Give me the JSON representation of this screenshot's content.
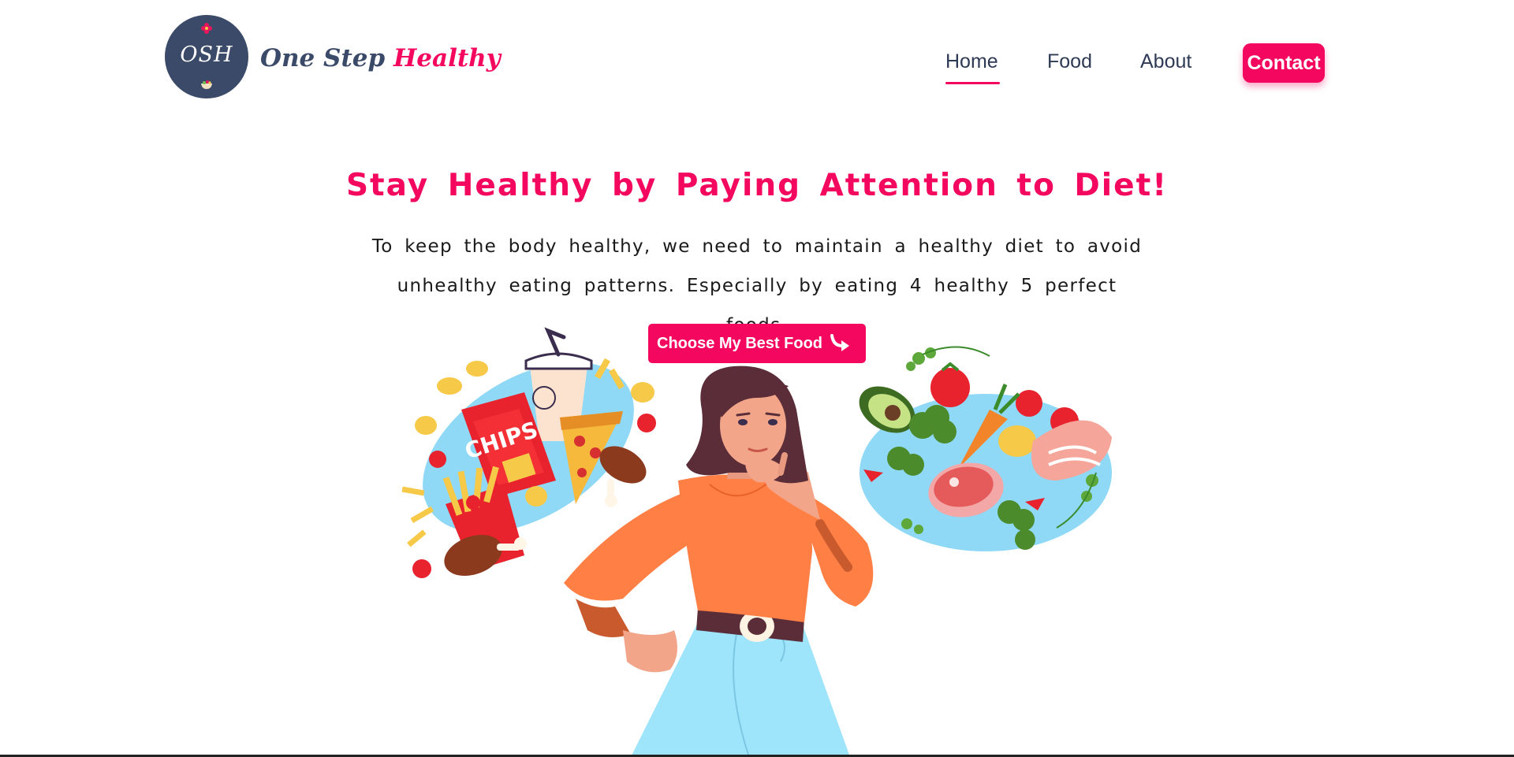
{
  "brand": {
    "logo_text": "OSH",
    "name_part1": "One Step",
    "name_part2": "Healthy"
  },
  "nav": {
    "items": [
      "Home",
      "Food",
      "About"
    ],
    "active": "Home",
    "contact_label": "Contact"
  },
  "hero": {
    "title": "Stay Healthy by Paying Attention to Diet!",
    "description": "To keep the body healthy, we need to maintain a healthy diet to avoid unhealthy eating patterns. Especially by eating 4 healthy 5 perfect foods.",
    "cta_label": "Choose My Best Food",
    "illustration": {
      "left_plate": "junk-food",
      "left_plate_text": "CHIPS",
      "right_plate": "healthy-food",
      "figure": "thinking-woman"
    }
  },
  "colors": {
    "accent": "#f4075f",
    "brand_navy": "#3b4a68",
    "plate_blue": "#8fd9f7",
    "shirt_orange": "#ff7f45"
  },
  "icons": [
    "flower-icon",
    "bowl-icon",
    "arrow-turn-icon"
  ]
}
